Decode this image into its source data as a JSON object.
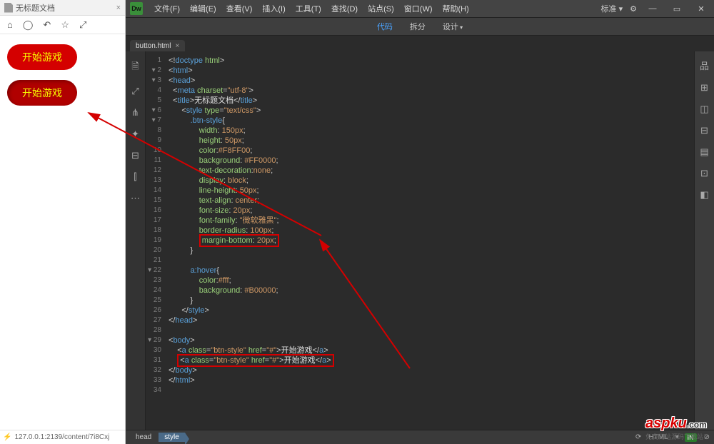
{
  "preview": {
    "tab_title": "无标题文档",
    "toolbar_icons": [
      "⌂",
      "◯",
      "↶",
      "☆",
      "⤢"
    ],
    "buttons": [
      {
        "label": "开始游戏"
      },
      {
        "label": "开始游戏"
      }
    ],
    "status": "127.0.0.1:2139/content/7i8Cxj"
  },
  "menubar": {
    "logo": "Dw",
    "items": [
      "文件(F)",
      "编辑(E)",
      "查看(V)",
      "插入(I)",
      "工具(T)",
      "查找(D)",
      "站点(S)",
      "窗口(W)",
      "帮助(H)"
    ],
    "layout_label": "标准",
    "settings_icon": "⚙"
  },
  "viewbar": {
    "items": [
      {
        "label": "代码",
        "active": true
      },
      {
        "label": "拆分"
      },
      {
        "label": "设计",
        "dropdown": true
      }
    ]
  },
  "file_tab": {
    "name": "button.html"
  },
  "vtool_icons": [
    "🗎",
    "⤢",
    "⋔",
    "✦",
    "⊟",
    "⫿",
    "⋯"
  ],
  "rrail_icons": [
    "品",
    "⊞",
    "◫",
    "⊟",
    "▤",
    "⊡",
    "◧"
  ],
  "code_lines": [
    {
      "n": 1,
      "h": "<span class='t-ang'>&lt;!</span><span class='t-tag'>doctype</span> <span class='t-attr'>html</span><span class='t-ang'>&gt;</span>"
    },
    {
      "n": 2,
      "f": "▾",
      "h": "<span class='t-ang'>&lt;</span><span class='t-tag'>html</span><span class='t-ang'>&gt;</span>"
    },
    {
      "n": 3,
      "f": "▾",
      "h": "<span class='t-ang'>&lt;</span><span class='t-tag'>head</span><span class='t-ang'>&gt;</span>"
    },
    {
      "n": 4,
      "h": "  <span class='t-ang'>&lt;</span><span class='t-tag'>meta</span> <span class='t-attr'>charset</span>=<span class='t-val'>\"utf-8\"</span><span class='t-ang'>&gt;</span>"
    },
    {
      "n": 5,
      "h": "  <span class='t-ang'>&lt;</span><span class='t-tag'>title</span><span class='t-ang'>&gt;</span><span class='t-text'>无标题文档</span><span class='t-ang'>&lt;/</span><span class='t-tag'>title</span><span class='t-ang'>&gt;</span>"
    },
    {
      "n": 6,
      "f": "▾",
      "h": "      <span class='t-ang'>&lt;</span><span class='t-tag'>style</span> <span class='t-attr'>type</span>=<span class='t-val'>\"text/css\"</span><span class='t-ang'>&gt;</span>"
    },
    {
      "n": 7,
      "f": "▾",
      "h": "          <span class='t-tag'>.btn-style</span>{"
    },
    {
      "n": 8,
      "h": "              <span class='t-prop'>width</span>: <span class='t-pval'>150px</span>;"
    },
    {
      "n": 9,
      "h": "              <span class='t-prop'>height</span>: <span class='t-pval'>50px</span>;"
    },
    {
      "n": 10,
      "h": "              <span class='t-prop'>color</span>:<span class='t-pval'>#F8FF00</span>;"
    },
    {
      "n": 11,
      "h": "              <span class='t-prop'>background</span>: <span class='t-pval'>#FF0000</span>;"
    },
    {
      "n": 12,
      "h": "              <span class='t-prop'>text-decoration</span>:<span class='t-pval'>none</span>;"
    },
    {
      "n": 13,
      "h": "              <span class='t-prop'>display</span>: <span class='t-pval'>block</span>;"
    },
    {
      "n": 14,
      "h": "              <span class='t-prop'>line-height</span>: <span class='t-pval'>50px</span>;"
    },
    {
      "n": 15,
      "h": "              <span class='t-prop'>text-align</span>: <span class='t-pval'>center</span>;"
    },
    {
      "n": 16,
      "h": "              <span class='t-prop'>font-size</span>: <span class='t-pval'>20px</span>;"
    },
    {
      "n": 17,
      "h": "              <span class='t-prop'>font-family</span>: <span class='t-val'>\"微软雅黑\"</span>;"
    },
    {
      "n": 18,
      "h": "              <span class='t-prop'>border-radius</span>: <span class='t-pval'>100px</span>;"
    },
    {
      "n": 19,
      "hl": true,
      "h": "              <span class='hlbox'><span class='t-prop'>margin-bottom</span>: <span class='t-pval'>20px</span>;</span>"
    },
    {
      "n": 20,
      "h": "          }"
    },
    {
      "n": 21,
      "h": ""
    },
    {
      "n": 22,
      "f": "▾",
      "h": "          <span class='t-tag'>a:hover</span>{"
    },
    {
      "n": 23,
      "h": "              <span class='t-prop'>color</span>:<span class='t-pval'>#fff</span>;"
    },
    {
      "n": 24,
      "h": "              <span class='t-prop'>background</span>: <span class='t-pval'>#B00000</span>;"
    },
    {
      "n": 25,
      "h": "          }"
    },
    {
      "n": 26,
      "h": "      <span class='t-ang'>&lt;/</span><span class='t-tag'>style</span><span class='t-ang'>&gt;</span>"
    },
    {
      "n": 27,
      "h": "<span class='t-ang'>&lt;/</span><span class='t-tag'>head</span><span class='t-ang'>&gt;</span>"
    },
    {
      "n": 28,
      "h": ""
    },
    {
      "n": 29,
      "f": "▾",
      "h": "<span class='t-ang'>&lt;</span><span class='t-tag'>body</span><span class='t-ang'>&gt;</span>"
    },
    {
      "n": 30,
      "h": "    <span class='t-ang'>&lt;</span><span class='t-tag'>a</span> <span class='t-attr'>class</span>=<span class='t-val'>\"btn-style\"</span> <span class='t-attr'>href</span>=<span class='t-val'>\"#\"</span><span class='t-ang'>&gt;</span><span class='t-text'>开始游戏</span><span class='t-ang'>&lt;/</span><span class='t-tag'>a</span><span class='t-ang'>&gt;</span>"
    },
    {
      "n": 31,
      "hl": true,
      "h": "    <span class='hlbox'><span class='t-ang'>&lt;</span><span class='t-tag'>a</span> <span class='t-attr'>class</span>=<span class='t-val'>\"btn-style\"</span> <span class='t-attr'>href</span>=<span class='t-val'>\"#\"</span><span class='t-ang'>&gt;</span><span class='t-text'>开始游戏</span><span class='t-ang'>&lt;/</span><span class='t-tag'>a</span><span class='t-ang'>&gt;</span></span>"
    },
    {
      "n": 32,
      "h": "<span class='t-ang'>&lt;/</span><span class='t-tag'>body</span><span class='t-ang'>&gt;</span>"
    },
    {
      "n": 33,
      "h": "<span class='t-ang'>&lt;/</span><span class='t-tag'>html</span><span class='t-ang'>&gt;</span>"
    },
    {
      "n": 34,
      "h": ""
    }
  ],
  "crumb": {
    "path": [
      "head",
      "style"
    ],
    "sync_icon": "⟳",
    "html_label": "HTML",
    "ins_label": "IN",
    "extra": "⊘"
  },
  "watermark": {
    "brand": "aspku",
    "suffix": ".com",
    "sub": "免费网站源码下载站！"
  }
}
